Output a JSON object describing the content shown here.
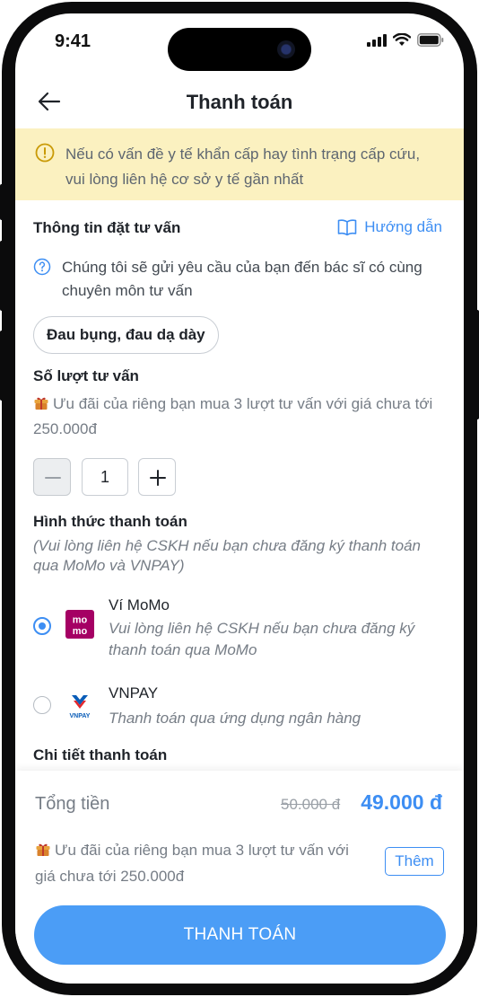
{
  "status_bar": {
    "time": "9:41"
  },
  "header": {
    "title": "Thanh toán"
  },
  "alert": {
    "text": "Nếu có vấn đề y tế khẩn cấp hay tình trạng cấp cứu, vui lòng liên hệ cơ sở y tế gần nhất"
  },
  "booking": {
    "title": "Thông tin đặt tư vấn",
    "guide_label": "Hướng dẫn",
    "info_text": "Chúng tôi sẽ gửi yêu cầu của bạn đến bác sĩ có cùng chuyên môn tư vấn",
    "symptom_chip": "Đau bụng, đau dạ dày"
  },
  "sessions": {
    "title": "Số lượt tư vấn",
    "promo": "Ưu đãi của riêng bạn mua 3 lượt tư vấn với giá chưa tới 250.000đ",
    "quantity": "1"
  },
  "payment_method": {
    "title": "Hình thức thanh toán",
    "note": "(Vui lòng liên hệ CSKH nếu bạn chưa đăng ký thanh toán qua MoMo và VNPAY)",
    "options": [
      {
        "name": "Ví MoMo",
        "desc": "Vui lòng liên hệ CSKH nếu bạn chưa đăng ký thanh toán qua MoMo",
        "selected": true,
        "logo_text_top": "mo",
        "logo_text_bottom": "mo",
        "logo_color": "#a50064"
      },
      {
        "name": "VNPAY",
        "desc": "Thanh toán qua ứng dụng ngân hàng",
        "selected": false,
        "logo_text": "VNPAY"
      }
    ]
  },
  "payment_detail": {
    "title": "Chi tiết thanh toán"
  },
  "summary": {
    "total_label": "Tổng tiền",
    "old_price": "50.000 đ",
    "new_price": "49.000 đ",
    "promo": "Ưu đãi của riêng bạn mua 3 lượt tư vấn với giá chưa tới 250.000đ",
    "more_label": "Thêm",
    "pay_label": "THANH TOÁN"
  },
  "colors": {
    "accent": "#3d8ef3",
    "alert_bg": "#fbf1c0",
    "momo": "#a50064"
  }
}
